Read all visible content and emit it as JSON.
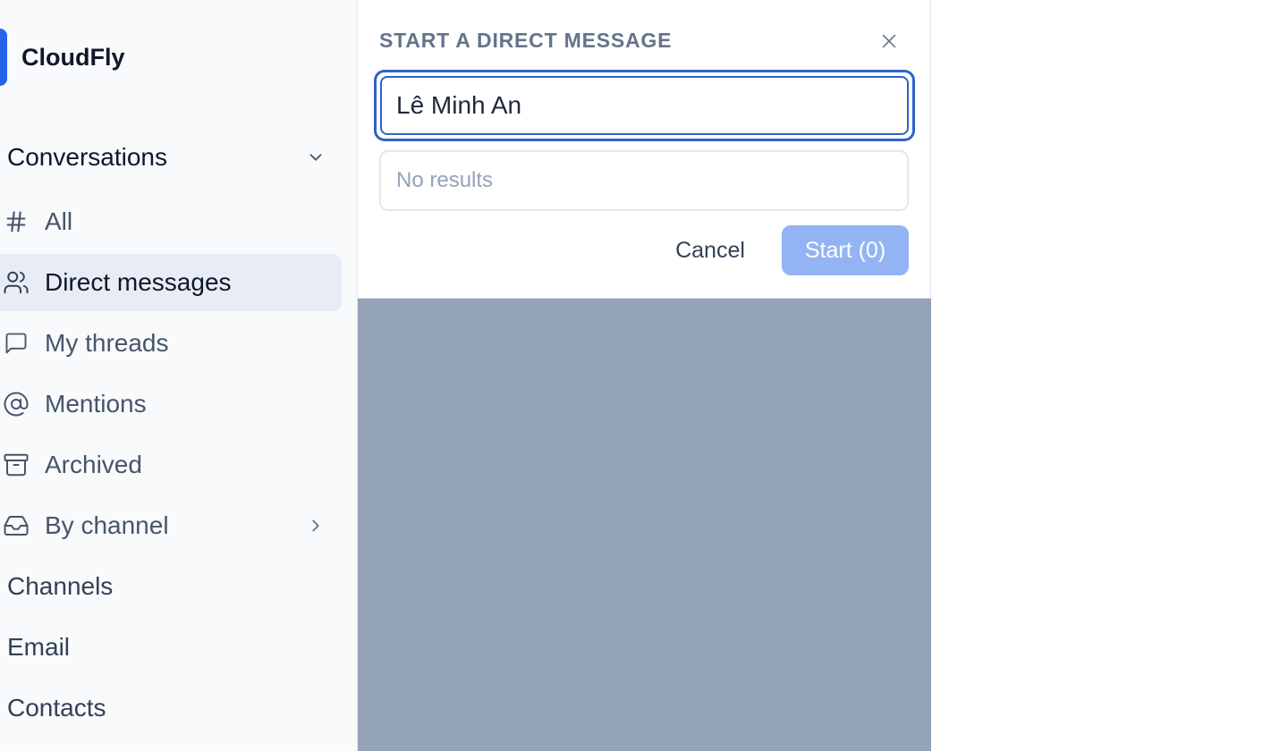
{
  "brand": {
    "name": "CloudFly"
  },
  "sidebar": {
    "section_title": "Conversations",
    "items": [
      {
        "label": "All",
        "icon": "hash-icon"
      },
      {
        "label": "Direct messages",
        "icon": "users-icon",
        "active": true
      },
      {
        "label": "My threads",
        "icon": "message-square-icon"
      },
      {
        "label": "Mentions",
        "icon": "at-sign-icon"
      },
      {
        "label": "Archived",
        "icon": "archive-icon"
      },
      {
        "label": "By channel",
        "icon": "inbox-icon"
      }
    ],
    "plain_items": [
      {
        "label": "Channels"
      },
      {
        "label": "Email"
      },
      {
        "label": "Contacts"
      }
    ]
  },
  "dialog": {
    "title": "START A DIRECT MESSAGE",
    "search_value": "Lê Minh An",
    "results_text": "No results",
    "cancel_label": "Cancel",
    "start_label": "Start (0)"
  },
  "colors": {
    "accent": "#2563eb",
    "focus_ring": "#2f62c9",
    "start_disabled": "#93b4f4",
    "overlay": "#94a3b8",
    "active_item_bg": "#e8edf5"
  }
}
